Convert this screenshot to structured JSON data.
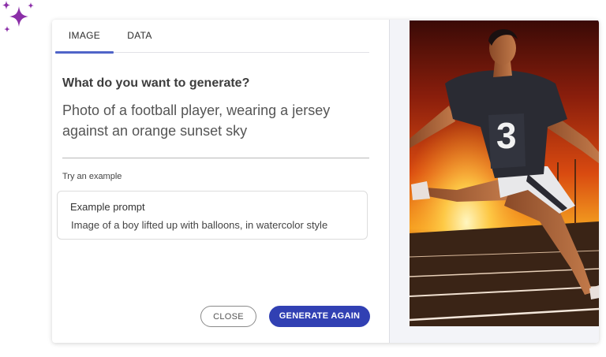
{
  "tabs": [
    {
      "label": "IMAGE",
      "active": true
    },
    {
      "label": "DATA",
      "active": false
    }
  ],
  "prompt": {
    "question": "What do you want to generate?",
    "text": "Photo of a football player, wearing a jersey against an orange sunset sky"
  },
  "examples": {
    "section_label": "Try an example",
    "card_title": "Example prompt",
    "card_text": "Image of a boy lifted up with balloons, in watercolor style"
  },
  "buttons": {
    "close": "CLOSE",
    "generate": "GENERATE AGAIN"
  },
  "image": {
    "jersey_number": "3"
  },
  "colors": {
    "accent": "#4f64c8",
    "primary_button": "#3140b3",
    "sparkle": "#8b2fa8"
  }
}
